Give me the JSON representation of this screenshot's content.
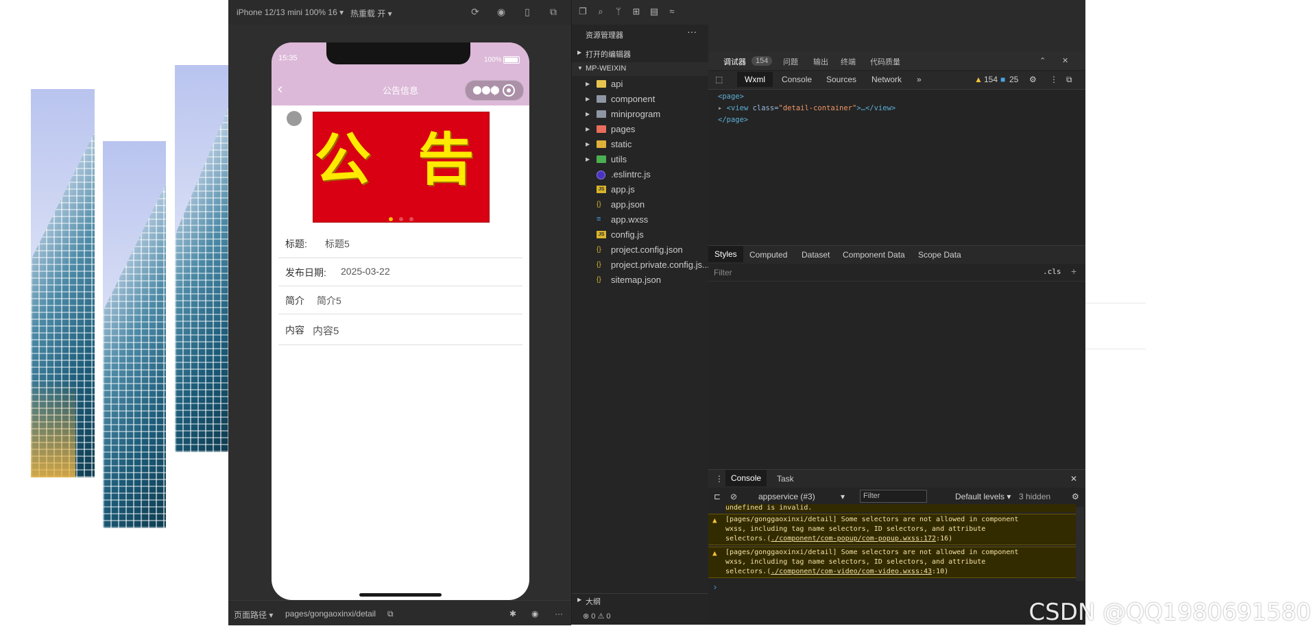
{
  "simulator": {
    "device": "iPhone 12/13 mini 100% 16 ▾",
    "hot_reload": "热重载 开 ▾",
    "bottom_path_label": "页面路径 ▾",
    "bottom_path": "pages/gongaoxinxi/detail"
  },
  "phone": {
    "time": "15:35",
    "battery": "100%",
    "nav_title": "公告信息",
    "banner_text": "公 告",
    "rows": [
      {
        "label": "标题:",
        "value": "标题5"
      },
      {
        "label": "发布日期:",
        "value": "2025-03-22"
      },
      {
        "label": "简介",
        "value": "简介5"
      },
      {
        "label": "内容",
        "value": "内容5"
      }
    ]
  },
  "explorer": {
    "title": "资源管理器",
    "more": "···",
    "open_editors": "打开的编辑器",
    "project": "MP-WEIXIN",
    "items": [
      {
        "name": "api",
        "type": "folder"
      },
      {
        "name": "component",
        "type": "folder"
      },
      {
        "name": "miniprogram",
        "type": "folder"
      },
      {
        "name": "pages",
        "type": "folder"
      },
      {
        "name": "static",
        "type": "folder"
      },
      {
        "name": "utils",
        "type": "folder"
      },
      {
        "name": ".eslintrc.js",
        "type": "eslint"
      },
      {
        "name": "app.js",
        "type": "js"
      },
      {
        "name": "app.json",
        "type": "json"
      },
      {
        "name": "app.wxss",
        "type": "css"
      },
      {
        "name": "config.js",
        "type": "js"
      },
      {
        "name": "project.config.json",
        "type": "json"
      },
      {
        "name": "project.private.config.js...",
        "type": "json"
      },
      {
        "name": "sitemap.json",
        "type": "json"
      }
    ],
    "outline": "大纲",
    "status": "⊗ 0 ⚠ 0"
  },
  "debugger": {
    "tabs1": [
      "调试器",
      "问题",
      "输出",
      "终端",
      "代码质量"
    ],
    "tabs1_badge": "154",
    "tabs2": [
      "Wxml",
      "Console",
      "Sources",
      "Network"
    ],
    "warn_count": "154",
    "info_count": "25",
    "wxml": {
      "page_open": "<page>",
      "view_line_tag": "<view",
      "view_attr_name": "class=",
      "view_attr_value": "\"detail-container\"",
      "view_tail": ">…</view>",
      "page_close": "</page>"
    },
    "styles_tabs": [
      "Styles",
      "Computed",
      "Dataset",
      "Component Data",
      "Scope Data"
    ],
    "filter_placeholder": "Filter",
    "cls": ".cls",
    "console_tabs": [
      "Console",
      "Task"
    ],
    "context": "appservice (#3)",
    "console_filter": "Filter",
    "levels": "Default levels ▾",
    "hidden": "3 hidden",
    "undefined_line": "undefined is invalid.",
    "warnings": [
      {
        "text": "[pages/gonggaoxinxi/detail] Some selectors are not allowed in component\nwxss, including tag name selectors, ID selectors, and attribute\nselectors.(",
        "link": "./component/com-popup/com-popup.wxss:172",
        "tail": ":16)"
      },
      {
        "text": "[pages/gonggaoxinxi/detail] Some selectors are not allowed in component\nwxss, including tag name selectors, ID selectors, and attribute\nselectors.(",
        "link": "./component/com-video/com-video.wxss:43",
        "tail": ":10)"
      }
    ]
  },
  "watermark": "CSDN @QQ1980691580",
  "colors": {
    "nav_bg": "#dcb9d8",
    "banner_bg": "#d90013",
    "banner_text": "#ffea00",
    "ide_bg": "#2e2e2e"
  }
}
